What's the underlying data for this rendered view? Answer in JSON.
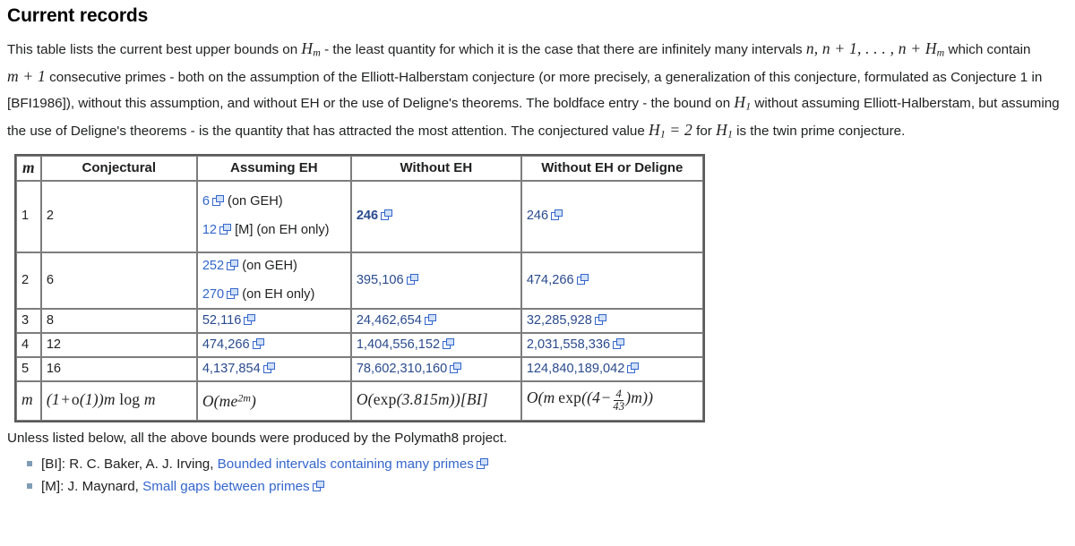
{
  "heading": "Current records",
  "intro": {
    "t1": "This table lists the current best upper bounds on ",
    "m1": "H",
    "m1sub": "m",
    "t2": " - the least quantity for which it is the case that there are infinitely many intervals ",
    "m2": "n, n + 1, . . . , n + H",
    "m2sub": "m",
    "t3": " which contain ",
    "m3": "m + 1",
    "t4": " consecutive primes - both on the assumption of the Elliott-Halberstam conjecture (or more precisely, a generalization of this conjecture, formulated as Conjecture 1 in [BFI1986]), without this assumption, and without EH or the use of Deligne's theorems. The boldface entry - the bound on ",
    "m4": "H",
    "m4sub": "1",
    "t5": " without assuming Elliott-Halberstam, but assuming the use of Deligne's theorems - is the quantity that has attracted the most attention. The conjectured value ",
    "m5a": "H",
    "m5asub": "1",
    "m5b": "= 2",
    "t6": " for ",
    "m6": "H",
    "m6sub": "1",
    "t7": " is the twin prime conjecture."
  },
  "table": {
    "headers": {
      "m": "m",
      "conjectural": "Conjectural",
      "assuming_eh": "Assuming EH",
      "without_eh": "Without EH",
      "without_eh_or_deligne": "Without EH or Deligne"
    },
    "rows": [
      {
        "m": "1",
        "conjectural": "2",
        "assuming_eh": [
          {
            "value": "6",
            "note": " (on GEH)",
            "link": true
          },
          {
            "value": "12",
            "note": " [M] (on EH only)",
            "link": true
          }
        ],
        "without_eh": [
          {
            "value": "246",
            "note": "",
            "link": true,
            "bold": true
          }
        ],
        "without_eh_or_deligne": [
          {
            "value": "246",
            "note": "",
            "link": true
          }
        ]
      },
      {
        "m": "2",
        "conjectural": "6",
        "assuming_eh": [
          {
            "value": "252",
            "note": " (on GEH)",
            "link": true
          },
          {
            "value": "270",
            "note": " (on EH only)",
            "link": true
          }
        ],
        "without_eh": [
          {
            "value": "395,106",
            "note": "",
            "link": true
          }
        ],
        "without_eh_or_deligne": [
          {
            "value": "474,266",
            "note": "",
            "link": true
          }
        ]
      },
      {
        "m": "3",
        "conjectural": "8",
        "assuming_eh": [
          {
            "value": "52,116",
            "note": "",
            "link": true
          }
        ],
        "without_eh": [
          {
            "value": "24,462,654",
            "note": "",
            "link": true
          }
        ],
        "without_eh_or_deligne": [
          {
            "value": "32,285,928",
            "note": "",
            "link": true
          }
        ]
      },
      {
        "m": "4",
        "conjectural": "12",
        "assuming_eh": [
          {
            "value": "474,266",
            "note": "",
            "link": true
          }
        ],
        "without_eh": [
          {
            "value": "1,404,556,152",
            "note": "",
            "link": true
          }
        ],
        "without_eh_or_deligne": [
          {
            "value": "2,031,558,336",
            "note": "",
            "link": true
          }
        ]
      },
      {
        "m": "5",
        "conjectural": "16",
        "assuming_eh": [
          {
            "value": "4,137,854",
            "note": "",
            "link": true
          }
        ],
        "without_eh": [
          {
            "value": "78,602,310,160",
            "note": "",
            "link": true
          }
        ],
        "without_eh_or_deligne": [
          {
            "value": "124,840,189,042",
            "note": "",
            "link": true
          }
        ]
      }
    ],
    "asymptotic_row": {
      "m": "m",
      "conjectural": "(1 + o(1))m log m",
      "assuming_eh": "O(me^2m)",
      "without_eh": "O(exp(3.815m))[BI]",
      "without_eh_or_deligne": "O(m exp((4 - 4/43)m))"
    }
  },
  "afternote": "Unless listed below, all the above bounds were produced by the Polymath8 project.",
  "references": [
    {
      "tag": "[BI]:",
      "authors": " R. C. Baker, A. J. Irving, ",
      "title": "Bounded intervals containing many primes"
    },
    {
      "tag": "[M]:",
      "authors": " J. Maynard, ",
      "title": "Small gaps between primes"
    }
  ],
  "colors": {
    "link": "#3366cc",
    "link_dark": "#2a4b8d",
    "text": "#202122",
    "table_border": "#5a5a5a",
    "cell_border": "#7d7d7d",
    "bullet": "#7f9cb5"
  },
  "icons": {
    "external_link": "external-link-icon"
  }
}
